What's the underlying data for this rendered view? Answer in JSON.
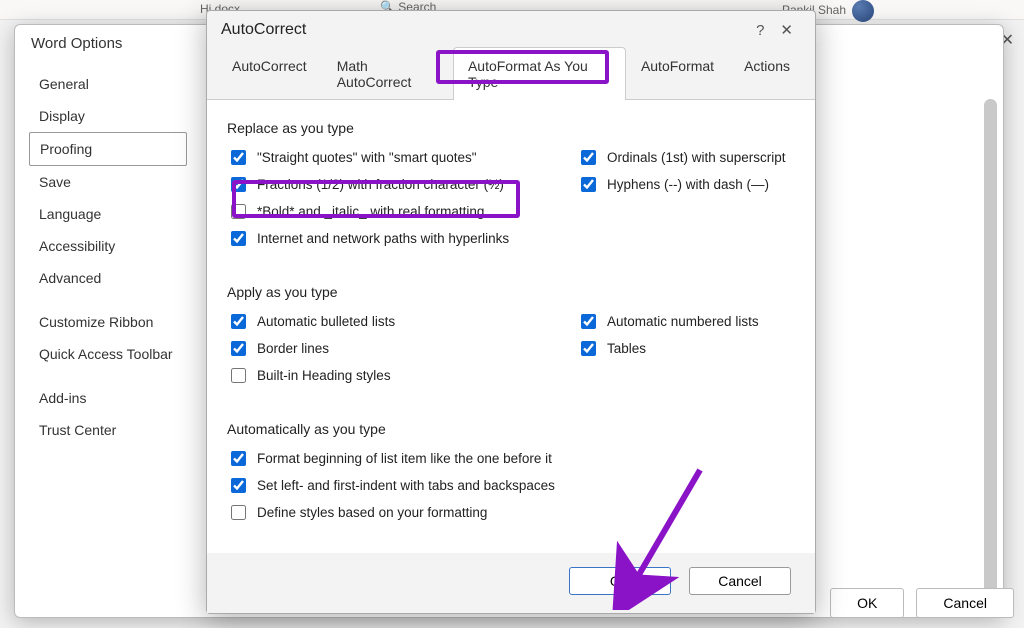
{
  "bg": {
    "filename": "Hi.docx",
    "search": "Search",
    "user": "Pankil Shah"
  },
  "word_options": {
    "title": "Word Options",
    "sidebar": {
      "items": [
        {
          "label": "General"
        },
        {
          "label": "Display"
        },
        {
          "label": "Proofing",
          "selected": true
        },
        {
          "label": "Save"
        },
        {
          "label": "Language"
        },
        {
          "label": "Accessibility"
        },
        {
          "label": "Advanced"
        },
        {
          "label": "Customize Ribbon",
          "group": true
        },
        {
          "label": "Quick Access Toolbar"
        },
        {
          "label": "Add-ins",
          "group": true
        },
        {
          "label": "Trust Center"
        }
      ]
    },
    "footer": {
      "ok": "OK",
      "cancel": "Cancel"
    }
  },
  "autocorrect": {
    "title": "AutoCorrect",
    "help_icon": "?",
    "close_icon": "✕",
    "tabs": [
      {
        "label": "AutoCorrect"
      },
      {
        "label": "Math AutoCorrect"
      },
      {
        "label": "AutoFormat As You Type",
        "active": true
      },
      {
        "label": "AutoFormat"
      },
      {
        "label": "Actions"
      }
    ],
    "sections": {
      "replace": {
        "title": "Replace as you type",
        "left": [
          {
            "label": "\"Straight quotes\" with \"smart quotes\"",
            "checked": true
          },
          {
            "label": "Fractions (1/2) with fraction character (½)",
            "checked": true
          },
          {
            "label": "*Bold* and _italic_ with real formatting",
            "checked": false
          },
          {
            "label": "Internet and network paths with hyperlinks",
            "checked": true
          }
        ],
        "right": [
          {
            "label": "Ordinals (1st) with superscript",
            "checked": true
          },
          {
            "label": "Hyphens (--) with dash (—)",
            "checked": true
          }
        ]
      },
      "apply": {
        "title": "Apply as you type",
        "left": [
          {
            "label": "Automatic bulleted lists",
            "checked": true
          },
          {
            "label": "Border lines",
            "checked": true
          },
          {
            "label": "Built-in Heading styles",
            "checked": false
          }
        ],
        "right": [
          {
            "label": "Automatic numbered lists",
            "checked": true
          },
          {
            "label": "Tables",
            "checked": true
          }
        ]
      },
      "auto": {
        "title": "Automatically as you type",
        "items": [
          {
            "label": "Format beginning of list item like the one before it",
            "checked": true
          },
          {
            "label": "Set left- and first-indent with tabs and backspaces",
            "checked": true
          },
          {
            "label": "Define styles based on your formatting",
            "checked": false
          }
        ]
      }
    },
    "footer": {
      "ok": "OK",
      "cancel": "Cancel"
    }
  }
}
